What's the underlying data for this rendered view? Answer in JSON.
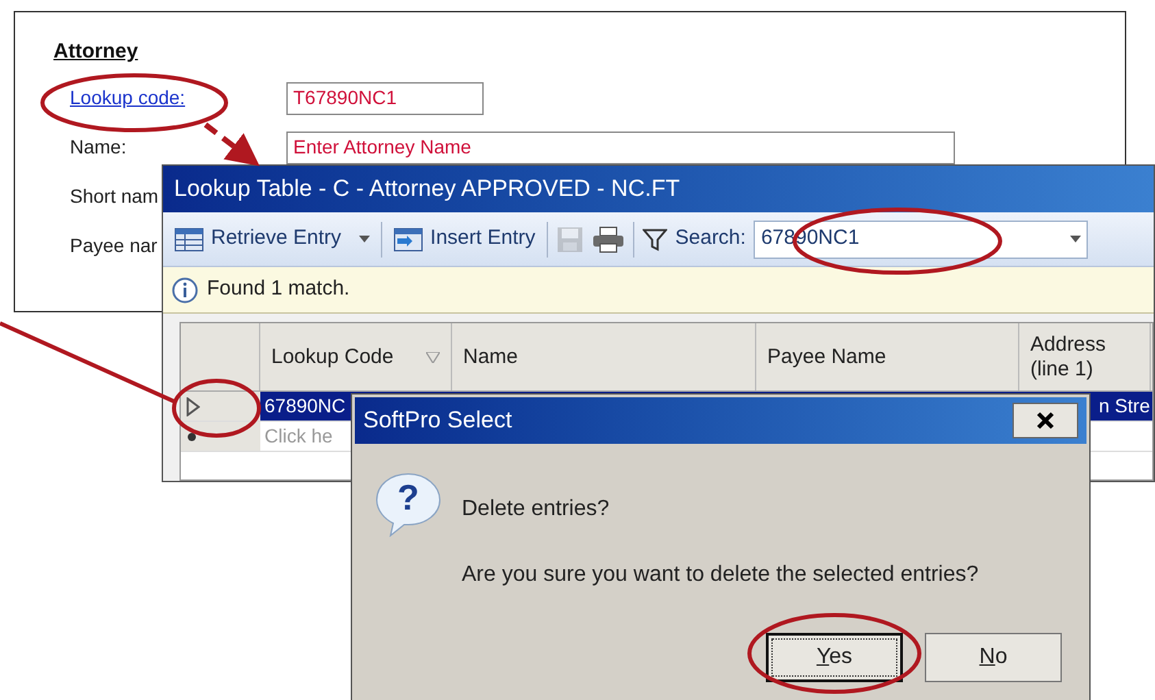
{
  "form": {
    "heading": "Attorney",
    "fields": [
      {
        "kind": "link",
        "label": "Lookup code:",
        "value": "T67890NC1"
      },
      {
        "kind": "text",
        "label": "Name:",
        "value": "Enter Attorney Name"
      },
      {
        "kind": "plain",
        "label": "Short nam"
      },
      {
        "kind": "plain",
        "label": "Payee nar"
      }
    ]
  },
  "lookup_window": {
    "title": "Lookup Table - C - Attorney APPROVED - NC.FT",
    "toolbar": {
      "retrieve": {
        "label": "Retrieve Entry",
        "dropdown": true
      },
      "insert": {
        "label": "Insert Entry"
      },
      "save": {
        "disabled": true
      },
      "search": {
        "label": "Search:",
        "value": "67890NC1"
      }
    },
    "info": "Found 1 match.",
    "table": {
      "columns": [
        "Lookup Code",
        "Name",
        "Payee Name",
        "Address (line 1)"
      ],
      "rows": [
        {
          "kind": "data",
          "selected": true,
          "cells": [
            "67890NC",
            "n Stre"
          ]
        },
        {
          "kind": "new",
          "selected": false,
          "cells": [
            "Click he"
          ]
        }
      ]
    }
  },
  "dialog": {
    "title": "SoftPro Select",
    "icon_glyph": "?",
    "heading": "Delete entries?",
    "message": "Are you sure you want to delete the selected entries?",
    "buttons": [
      {
        "label": "Yes",
        "focused": true
      },
      {
        "label": "No",
        "focused": false
      }
    ]
  }
}
